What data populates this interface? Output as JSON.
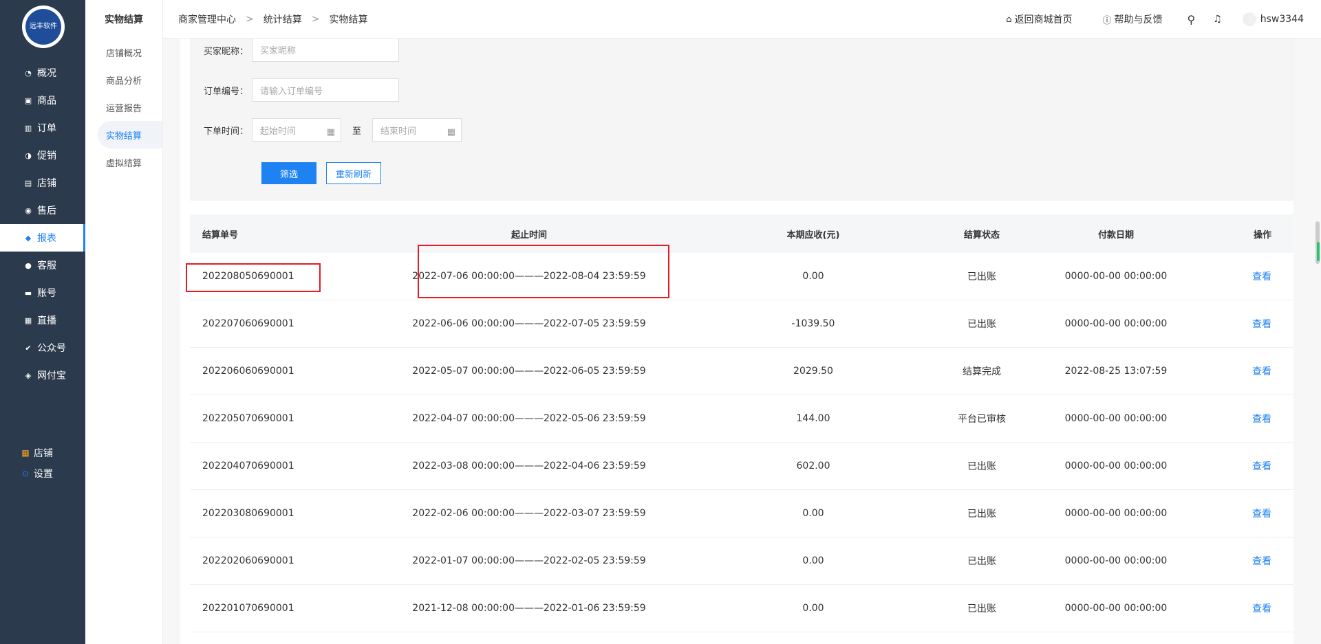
{
  "logo": {
    "text": "远丰软件"
  },
  "sidebar": {
    "items": [
      {
        "icon": "gauge-icon",
        "label": "概况",
        "glyph": "◔"
      },
      {
        "icon": "bag-icon",
        "label": "商品",
        "glyph": "▣"
      },
      {
        "icon": "bar-chart-icon",
        "label": "订单",
        "glyph": "▥"
      },
      {
        "icon": "promo-icon",
        "label": "促销",
        "glyph": "◑"
      },
      {
        "icon": "store-icon",
        "label": "店铺",
        "glyph": "▤"
      },
      {
        "icon": "after-sale-icon",
        "label": "售后",
        "glyph": "◉"
      },
      {
        "icon": "report-icon",
        "label": "报表",
        "glyph": "◆"
      },
      {
        "icon": "customer-service-icon",
        "label": "客服",
        "glyph": "●"
      },
      {
        "icon": "card-icon",
        "label": "账号",
        "glyph": "▬"
      },
      {
        "icon": "live-icon",
        "label": "直播",
        "glyph": "▦"
      },
      {
        "icon": "official-account-icon",
        "label": "公众号",
        "glyph": "✔"
      },
      {
        "icon": "shield-icon",
        "label": "网付宝",
        "glyph": "◈"
      }
    ],
    "active_index": 6,
    "bottom": [
      {
        "icon": "grid-icon",
        "label": "店铺",
        "glyph": "▦",
        "color": "#f5a623"
      },
      {
        "icon": "settings-icon",
        "label": "设置",
        "glyph": "⊙",
        "color": "#1e82f3"
      }
    ]
  },
  "subnav": {
    "title": "实物结算",
    "items": [
      "店铺概况",
      "商品分析",
      "运营报告",
      "实物结算",
      "虚拟结算"
    ],
    "active_index": 3
  },
  "topbar": {
    "breadcrumb": [
      "商家管理中心",
      "统计结算",
      "实物结算"
    ],
    "home_link": "返回商城首页",
    "help_link": "帮助与反馈",
    "username": "hsw3344"
  },
  "filter": {
    "buyer_label": "买家昵称：",
    "buyer_placeholder": "买家昵称",
    "order_label": "订单编号：",
    "order_placeholder": "请输入订单编号",
    "time_label": "下单时间：",
    "start_placeholder": "起始时间",
    "to_label": "至",
    "end_placeholder": "结束时间",
    "filter_button": "筛选",
    "refresh_button": "重新刷新"
  },
  "table": {
    "headers": [
      "结算单号",
      "起止时间",
      "本期应收(元)",
      "结算状态",
      "付款日期",
      "操作"
    ],
    "rows": [
      {
        "id": "202208050690001",
        "period": "2022-07-06 00:00:00———2022-08-04 23:59:59",
        "amount": "0.00",
        "status": "已出账",
        "paid": "0000-00-00 00:00:00",
        "action": "查看"
      },
      {
        "id": "202207060690001",
        "period": "2022-06-06 00:00:00———2022-07-05 23:59:59",
        "amount": "-1039.50",
        "status": "已出账",
        "paid": "0000-00-00 00:00:00",
        "action": "查看"
      },
      {
        "id": "202206060690001",
        "period": "2022-05-07 00:00:00———2022-06-05 23:59:59",
        "amount": "2029.50",
        "status": "结算完成",
        "paid": "2022-08-25 13:07:59",
        "action": "查看"
      },
      {
        "id": "202205070690001",
        "period": "2022-04-07 00:00:00———2022-05-06 23:59:59",
        "amount": "144.00",
        "status": "平台已审核",
        "paid": "0000-00-00 00:00:00",
        "action": "查看"
      },
      {
        "id": "202204070690001",
        "period": "2022-03-08 00:00:00———2022-04-06 23:59:59",
        "amount": "602.00",
        "status": "已出账",
        "paid": "0000-00-00 00:00:00",
        "action": "查看"
      },
      {
        "id": "202203080690001",
        "period": "2022-02-06 00:00:00———2022-03-07 23:59:59",
        "amount": "0.00",
        "status": "已出账",
        "paid": "0000-00-00 00:00:00",
        "action": "查看"
      },
      {
        "id": "202202060690001",
        "period": "2022-01-07 00:00:00———2022-02-05 23:59:59",
        "amount": "0.00",
        "status": "已出账",
        "paid": "0000-00-00 00:00:00",
        "action": "查看"
      },
      {
        "id": "202201070690001",
        "period": "2021-12-08 00:00:00———2022-01-06 23:59:59",
        "amount": "0.00",
        "status": "已出账",
        "paid": "0000-00-00 00:00:00",
        "action": "查看"
      }
    ]
  },
  "colors": {
    "accent": "#1e82f3",
    "sidebar": "#2b3a4d",
    "highlight": "#e51c23"
  }
}
